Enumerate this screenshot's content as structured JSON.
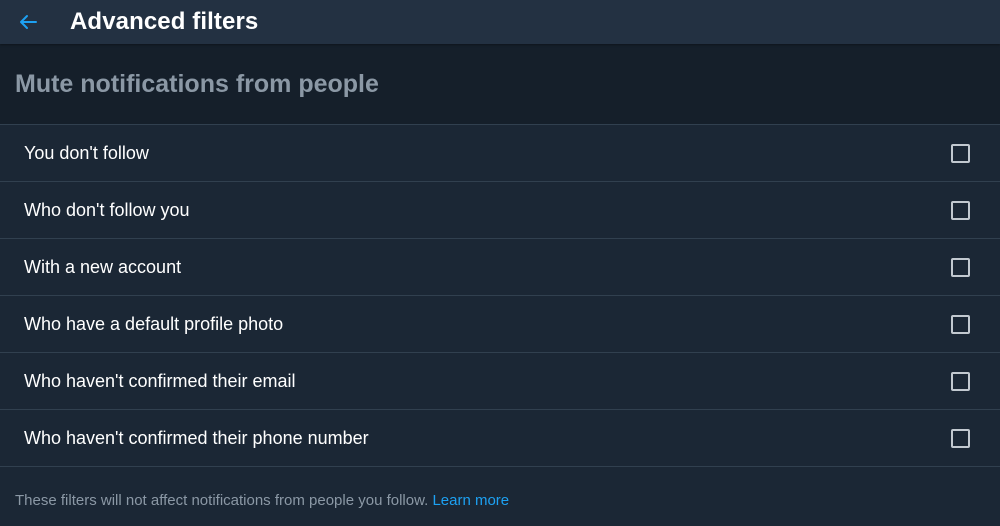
{
  "header": {
    "title": "Advanced filters",
    "back_icon": "back-arrow-icon",
    "accent_color": "#1da1f2"
  },
  "section": {
    "title": "Mute notifications from people"
  },
  "filters": [
    {
      "label": "You don't follow",
      "checked": false
    },
    {
      "label": "Who don't follow you",
      "checked": false
    },
    {
      "label": "With a new account",
      "checked": false
    },
    {
      "label": "Who have a default profile photo",
      "checked": false
    },
    {
      "label": "Who haven't confirmed their email",
      "checked": false
    },
    {
      "label": "Who haven't confirmed their phone number",
      "checked": false
    }
  ],
  "footer": {
    "text": "These filters will not affect notifications from people you follow.",
    "link": "Learn more"
  }
}
